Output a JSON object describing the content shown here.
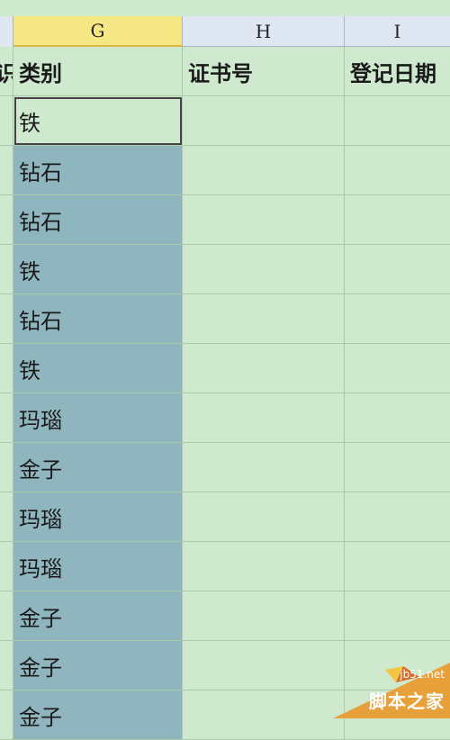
{
  "columns": {
    "g": "G",
    "h": "H",
    "i": "I"
  },
  "header_row": {
    "left_partial": "识",
    "g": "类别",
    "h": "证书号",
    "i": "登记日期"
  },
  "rows": [
    "铁",
    "钻石",
    "钻石",
    "铁",
    "钻石",
    "铁",
    "玛瑙",
    "金子",
    "玛瑙",
    "玛瑙",
    "金子",
    "金子",
    "金子"
  ],
  "watermark": {
    "url": "jb51.net",
    "text": "脚本之家"
  }
}
